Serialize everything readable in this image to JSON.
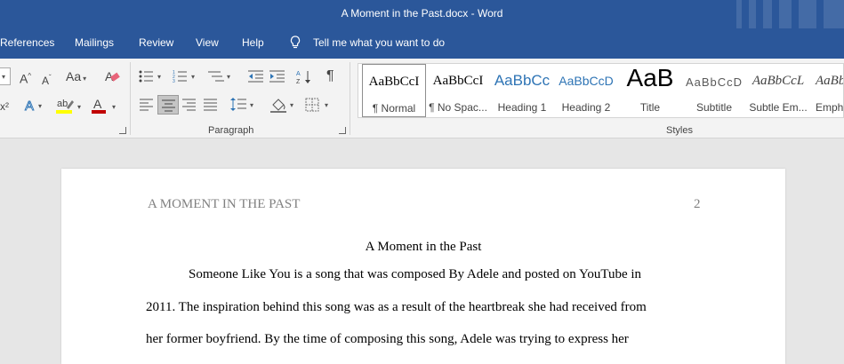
{
  "window": {
    "title": "A Moment in the Past.docx  -  Word",
    "theme_color": "#2b579a"
  },
  "menu": {
    "tabs": [
      "References",
      "Mailings",
      "Review",
      "View",
      "Help"
    ],
    "tell_me": "Tell me what you want to do"
  },
  "ribbon": {
    "groups": {
      "paragraph": "Paragraph",
      "styles": "Styles"
    },
    "font": {
      "change_case": "Aa",
      "grow": "A",
      "shrink": "A",
      "superscript_partial": "x²"
    },
    "paragraph_mark": "¶",
    "styles": [
      {
        "sample": "AaBbCcI",
        "name": "¶ Normal",
        "color": "#000000"
      },
      {
        "sample": "AaBbCcI",
        "name": "¶ No Spac...",
        "color": "#000000"
      },
      {
        "sample": "AaBbCc",
        "name": "Heading 1",
        "color": "#2e74b5"
      },
      {
        "sample": "AaBbCcD",
        "name": "Heading 2",
        "color": "#2e74b5"
      },
      {
        "sample": "AaB",
        "name": "Title",
        "color": "#000000"
      },
      {
        "sample": "AaBbCcD",
        "name": "Subtitle",
        "color": "#595959"
      },
      {
        "sample": "AaBbCcL",
        "name": "Subtle Em...",
        "color": "#404040"
      },
      {
        "sample": "AaBb",
        "name": "Emph",
        "color": "#404040"
      }
    ]
  },
  "document": {
    "running_head": "A MOMENT IN THE PAST",
    "page_number": "2",
    "title": "A Moment in the Past",
    "lines": [
      "Someone Like You is a song that was composed By Adele and posted on YouTube in",
      "2011. The inspiration behind this song was as a result of the heartbreak she had received from",
      "her former boyfriend. By the time of composing this song, Adele was trying to express her"
    ]
  }
}
